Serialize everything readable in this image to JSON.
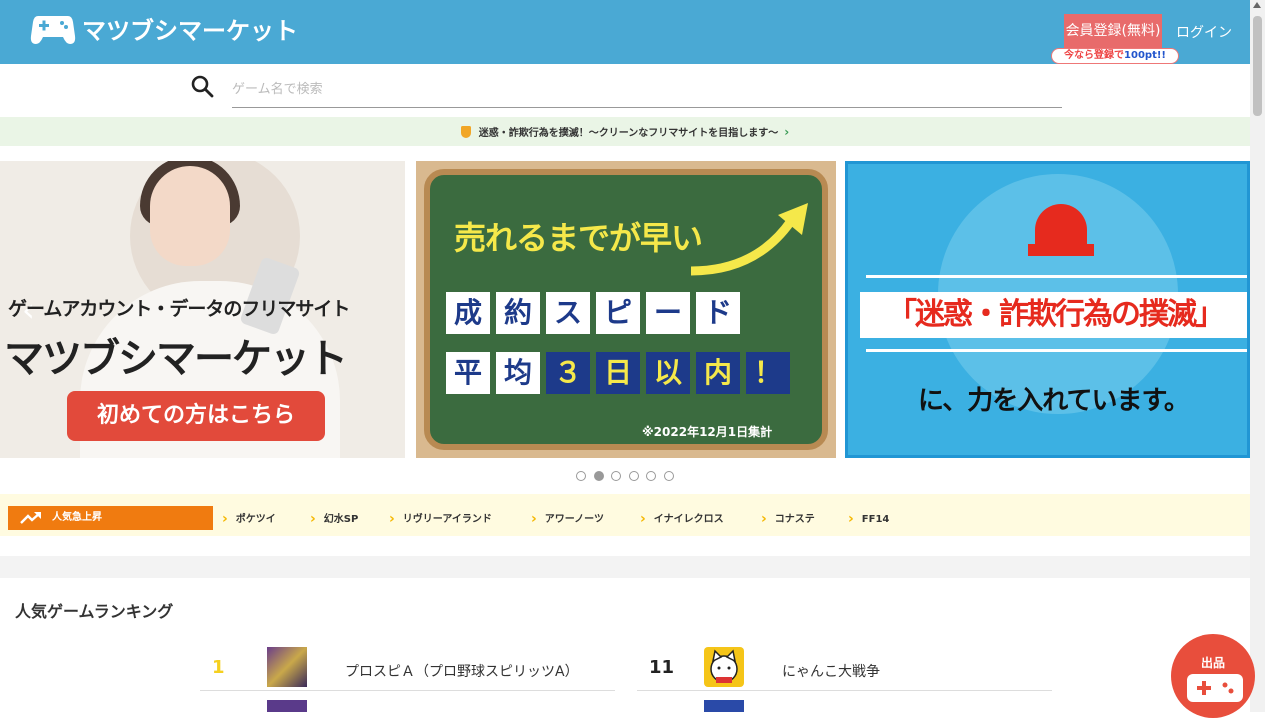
{
  "header": {
    "logo_text": "マツブシマーケット",
    "register_label": "会員登録(無料)",
    "register_badge_prefix": "今なら登録で",
    "register_badge_points": "100pt!!",
    "login_label": "ログイン"
  },
  "search": {
    "placeholder": "ゲーム名で検索"
  },
  "notice": {
    "text": "迷惑・詐欺行為を撲滅！〜クリーンなフリマサイトを目指します〜"
  },
  "banners": {
    "b1": {
      "subtitle": "ゲームアカウント・データのフリマサイト",
      "title": "マツブシマーケット",
      "cta": "初めての方はこちら"
    },
    "b2": {
      "headline": "売れるまでが早い",
      "row1": [
        "成",
        "約",
        "ス",
        "ピ",
        "ー",
        "ド"
      ],
      "row2": [
        "平",
        "均",
        "３",
        "日",
        "以",
        "内",
        "！"
      ],
      "note": "※2022年12月1日集計"
    },
    "b3": {
      "title": "「迷惑・詐欺行為の撲滅」",
      "subtitle": "に、力を入れています。"
    }
  },
  "carousel": {
    "dot_count": 6,
    "active_index": 1
  },
  "trending": {
    "label": "人気急上昇",
    "items": [
      "ポケツイ",
      "幻水SP",
      "リヴリーアイランド",
      "アワーノーツ",
      "イナイレクロス",
      "コナステ",
      "FF14"
    ]
  },
  "ranking": {
    "heading": "人気ゲームランキング",
    "left": [
      {
        "rank": "1",
        "name": "プロスピＡ（プロ野球スピリッツA）"
      }
    ],
    "right": [
      {
        "rank": "11",
        "name": "にゃんこ大戦争"
      }
    ]
  },
  "fab": {
    "label": "出品"
  },
  "colors": {
    "header_bg": "#4aa9d4",
    "register_bg": "#e86b6b",
    "trend_label_bg": "#f07b10",
    "fab_bg": "#e84e3c",
    "rank1_color": "#f5d020"
  }
}
